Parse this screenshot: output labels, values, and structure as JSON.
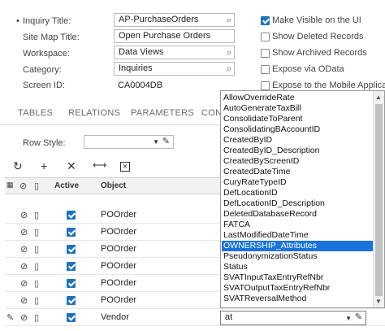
{
  "form": {
    "inquiry_title_label": "Inquiry Title:",
    "inquiry_title_value": "AP-PurchaseOrders",
    "sitemap_title_label": "Site Map Title:",
    "sitemap_title_value": "Open Purchase Orders",
    "workspace_label": "Workspace:",
    "workspace_value": "Data Views",
    "category_label": "Category:",
    "category_value": "Inquiries",
    "screen_id_label": "Screen ID:",
    "screen_id_value": "CA0004DB"
  },
  "options": {
    "make_visible": "Make Visible on the UI",
    "show_deleted": "Show Deleted Records",
    "show_archived": "Show Archived Records",
    "expose_odata": "Expose via OData",
    "expose_mobile": "Expose to the Mobile Application"
  },
  "tabs": [
    "TABLES",
    "RELATIONS",
    "PARAMETERS",
    "CON"
  ],
  "row_style_label": "Row Style:",
  "grid": {
    "col_active": "Active",
    "col_object": "Object",
    "rows": [
      {
        "object": "POOrder"
      },
      {
        "object": "POOrder"
      },
      {
        "object": "POOrder"
      },
      {
        "object": "POOrder"
      },
      {
        "object": "POOrder"
      },
      {
        "object": "POOrder"
      },
      {
        "object": "Vendor"
      }
    ]
  },
  "dropdown": {
    "items": [
      "AllowOverrideRate",
      "AutoGenerateTaxBill",
      "ConsolidateToParent",
      "ConsolidatingBAccountID",
      "CreatedByID",
      "CreatedByID_Description",
      "CreatedByScreenID",
      "CreatedDateTime",
      "CuryRateTypeID",
      "DefLocationID",
      "DefLocationID_Description",
      "DeletedDatabaseRecord",
      "FATCA",
      "LastModifiedDateTime",
      "OWNERSHIP_Attributes",
      "PseudonymizationStatus",
      "Status",
      "SVATInputTaxEntryRefNbr",
      "SVATOutputTaxEntryRefNbr",
      "SVATReversalMethod"
    ],
    "selected": "OWNERSHIP_Attributes",
    "input_value": "at"
  }
}
